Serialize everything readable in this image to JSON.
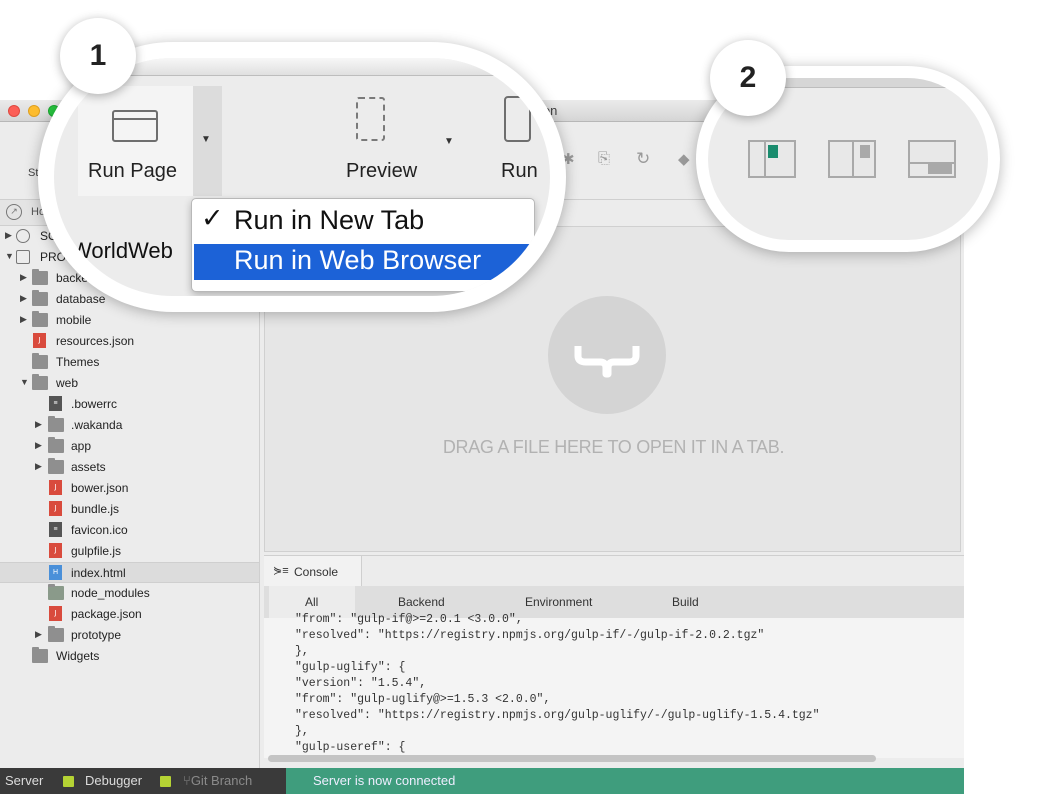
{
  "window": {
    "title_fragment": "ion"
  },
  "toolbar": {
    "left_label": "St"
  },
  "homebar": {
    "label": "Ho"
  },
  "tree": [
    {
      "label": "SOLUTI",
      "icon": "solution-icon",
      "arrow": "▶",
      "indent": 0,
      "kind": "solution"
    },
    {
      "label": "PROJECT: H",
      "icon": "project-icon",
      "arrow": "▼",
      "indent": 0,
      "kind": "project"
    },
    {
      "label": "backend",
      "icon": "folder-icon",
      "arrow": "▶",
      "indent": 1,
      "kind": "folder"
    },
    {
      "label": "database",
      "icon": "folder-icon",
      "arrow": "▶",
      "indent": 1,
      "kind": "folder"
    },
    {
      "label": "mobile",
      "icon": "folder-icon",
      "arrow": "▶",
      "indent": 1,
      "kind": "folder"
    },
    {
      "label": "resources.json",
      "icon": "json-file-icon",
      "arrow": "",
      "indent": 1,
      "kind": "j"
    },
    {
      "label": "Themes",
      "icon": "folder-icon",
      "arrow": "",
      "indent": 1,
      "kind": "folder"
    },
    {
      "label": "web",
      "icon": "web-folder-icon",
      "arrow": "▼",
      "indent": 1,
      "kind": "folder"
    },
    {
      "label": ".bowerrc",
      "icon": "text-file-icon",
      "arrow": "",
      "indent": 2,
      "kind": "g"
    },
    {
      "label": ".wakanda",
      "icon": "folder-icon",
      "arrow": "▶",
      "indent": 2,
      "kind": "folder"
    },
    {
      "label": "app",
      "icon": "folder-icon",
      "arrow": "▶",
      "indent": 2,
      "kind": "folder"
    },
    {
      "label": "assets",
      "icon": "folder-icon",
      "arrow": "▶",
      "indent": 2,
      "kind": "folder"
    },
    {
      "label": "bower.json",
      "icon": "json-file-icon",
      "arrow": "",
      "indent": 2,
      "kind": "j"
    },
    {
      "label": "bundle.js",
      "icon": "js-file-icon",
      "arrow": "",
      "indent": 2,
      "kind": "j"
    },
    {
      "label": "favicon.ico",
      "icon": "image-file-icon",
      "arrow": "",
      "indent": 2,
      "kind": "g"
    },
    {
      "label": "gulpfile.js",
      "icon": "js-file-icon",
      "arrow": "",
      "indent": 2,
      "kind": "j"
    },
    {
      "label": "index.html",
      "icon": "html-file-icon",
      "arrow": "",
      "indent": 2,
      "kind": "h",
      "selected": true
    },
    {
      "label": "node_modules",
      "icon": "node-modules-icon",
      "arrow": "",
      "indent": 2,
      "kind": "n"
    },
    {
      "label": "package.json",
      "icon": "json-file-icon",
      "arrow": "",
      "indent": 2,
      "kind": "j"
    },
    {
      "label": "prototype",
      "icon": "folder-icon",
      "arrow": "▶",
      "indent": 2,
      "kind": "folder"
    },
    {
      "label": "Widgets",
      "icon": "folder-icon",
      "arrow": "",
      "indent": 1,
      "kind": "folder"
    }
  ],
  "editor": {
    "drop_text": "DRAG A FILE HERE TO OPEN IT IN A TAB."
  },
  "console": {
    "tab_label": "Console",
    "subtabs": [
      "All",
      "Backend",
      "Environment",
      "Build"
    ],
    "active_subtab": "All",
    "lines": [
      "\"from\": \"gulp-if@>=2.0.1 <3.0.0\",",
      "\"resolved\": \"https://registry.npmjs.org/gulp-if/-/gulp-if-2.0.2.tgz\"",
      "},",
      "\"gulp-uglify\": {",
      "\"version\": \"1.5.4\",",
      "\"from\": \"gulp-uglify@>=1.5.3 <2.0.0\",",
      "\"resolved\": \"https://registry.npmjs.org/gulp-uglify/-/gulp-uglify-1.5.4.tgz\"",
      "},",
      "\"gulp-useref\": {"
    ]
  },
  "statusbar": {
    "server": "Server",
    "debugger": "Debugger",
    "git_branch": "Git Branch",
    "message": "Server is now connected"
  },
  "zoom1": {
    "badge": "1",
    "run_page": "Run Page",
    "preview": "Preview",
    "run": "Run",
    "menu_checked": "✓",
    "menu_items": [
      "Run in New Tab",
      "Run in Web Browser"
    ],
    "worldweb": "WorldWeb"
  },
  "zoom2": {
    "badge": "2"
  },
  "colors": {
    "accent_green": "#3f9d7d",
    "menu_highlight": "#1c62d7",
    "status_dot": "#b5d334",
    "layout_active": "#1a8c6e"
  }
}
